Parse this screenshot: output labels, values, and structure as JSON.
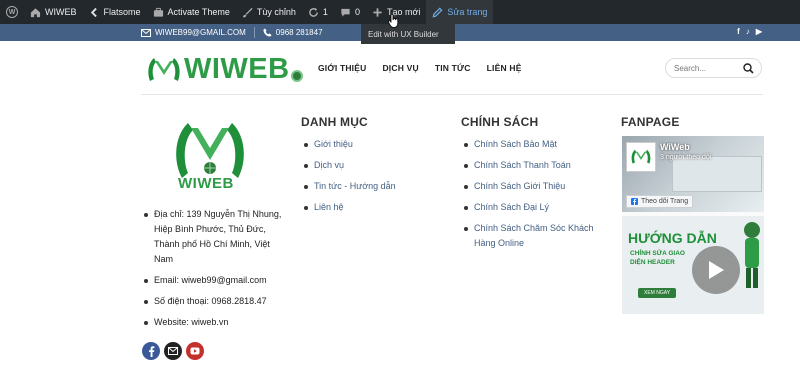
{
  "admin_bar": {
    "site_name": "WIWEB",
    "theme": "Flatsome",
    "activate_theme": "Activate Theme",
    "customize": "Tùy chỉnh",
    "updates_count": "1",
    "comments_count": "0",
    "new": "Tạo mới",
    "edit_page": "Sửa trang",
    "dropdown_item": "Edit with UX Builder"
  },
  "top_strip": {
    "email": "WIWEB99@GMAIL.COM",
    "phone": "0968 281847",
    "socials": [
      "f",
      "♪",
      "▶"
    ]
  },
  "header": {
    "logo_text": "WIWEB",
    "nav": [
      "GIỚI THIỆU",
      "DỊCH VỤ",
      "TIN TỨC",
      "LIÊN HỆ"
    ],
    "search_placeholder": "Search..."
  },
  "footer": {
    "col1": {
      "logo_text": "WIWEB",
      "address": "Địa chỉ: 139 Nguyễn Thị Nhung, Hiệp Bình Phước, Thủ Đức, Thành phố Hồ Chí Minh, Việt Nam",
      "email": "Email: wiweb99@gmail.com",
      "phone": "Số điện thoại: 0968.2818.47",
      "website": "Website: wiweb.vn"
    },
    "col2": {
      "title": "DANH MỤC",
      "links": [
        "Giới thiệu",
        "Dịch vụ",
        "Tin tức - Hướng dẫn",
        "Liên hệ"
      ]
    },
    "col3": {
      "title": "CHÍNH SÁCH",
      "links": [
        "Chính Sách Bảo Mật",
        "Chính Sách Thanh Toán",
        "Chính Sách Giới Thiệu",
        "Chính Sách Đại Lý",
        "Chính Sách Chăm Sóc Khách Hàng Online"
      ]
    },
    "col4": {
      "title": "FANPAGE",
      "page_name": "WiWeb",
      "followers": "3 người theo dõi",
      "follow_button": "Theo dõi Trang",
      "video_title": "HƯỚNG DẪN",
      "video_sub": "CHỈNH SỬA GIAO DIỆN HEADER",
      "video_cta": "XEM NGAY"
    }
  },
  "colors": {
    "admin_bar": "#23282d",
    "top_strip": "#446084",
    "brand_green": "#2e9b47",
    "link": "#446084"
  }
}
